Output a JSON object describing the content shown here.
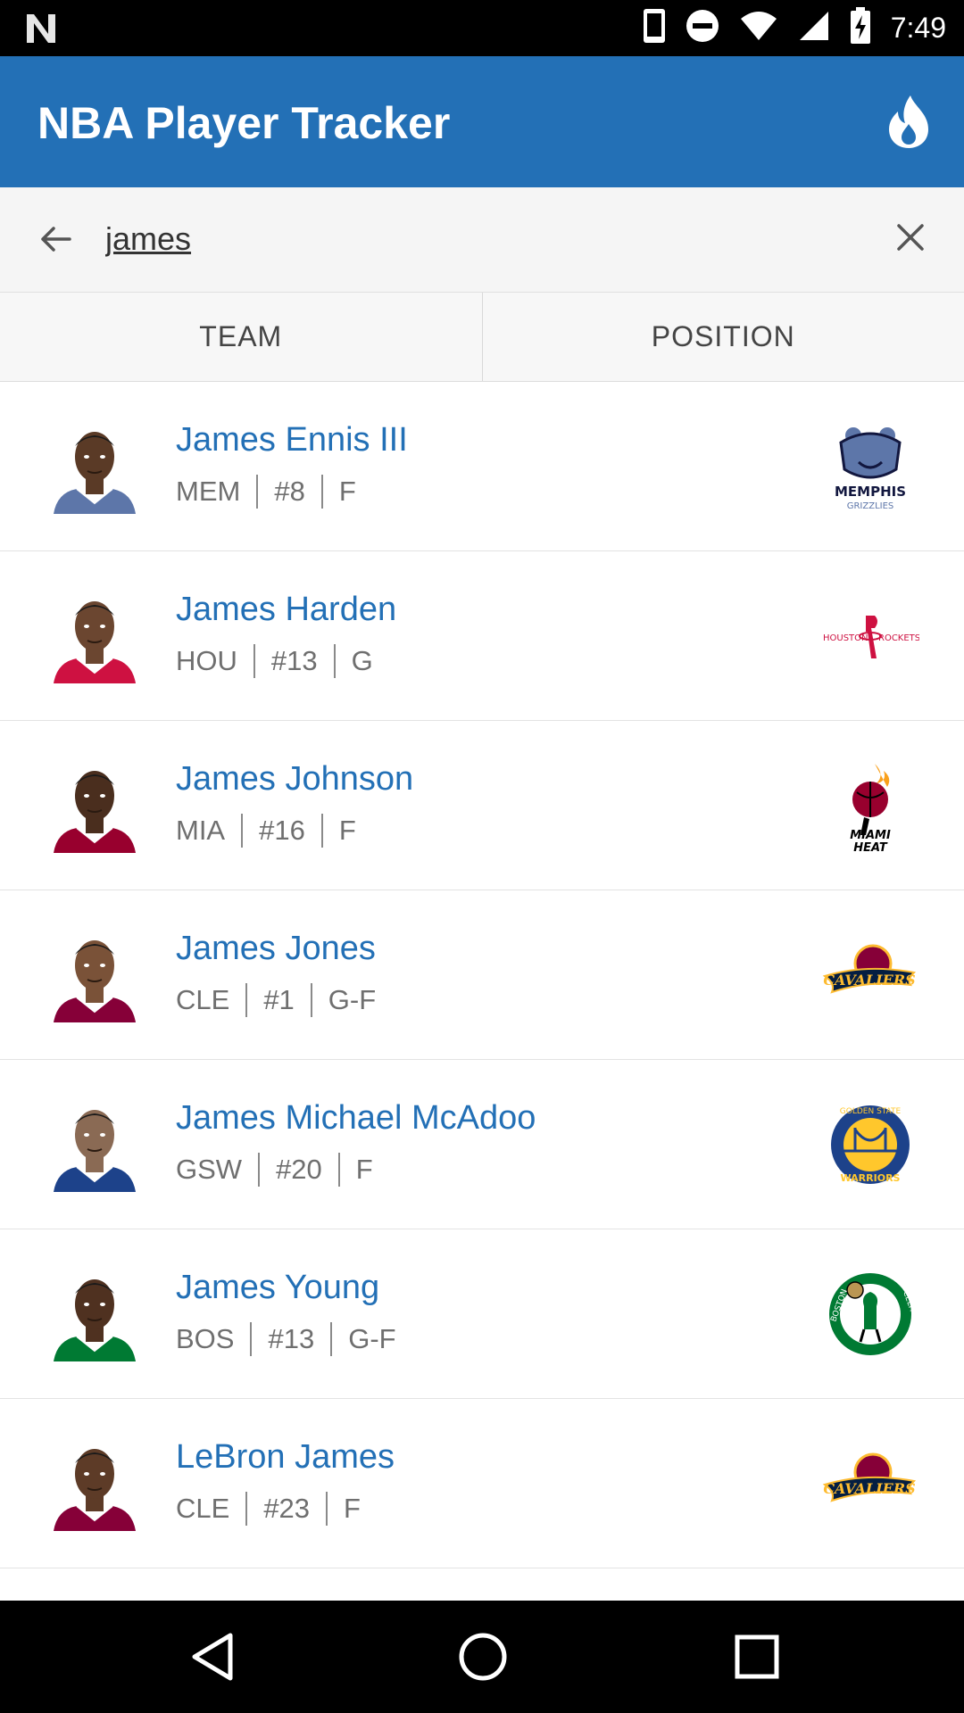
{
  "status_bar": {
    "time": "7:49",
    "icons": [
      "notification-n-icon",
      "phone-icon",
      "do-not-disturb-icon",
      "wifi-icon",
      "cell-signal-icon",
      "battery-charging-icon"
    ]
  },
  "app_bar": {
    "title": "NBA Player Tracker",
    "action_icon": "flame-icon"
  },
  "search": {
    "value": "james",
    "back_icon": "arrow-back-icon",
    "clear_icon": "close-icon"
  },
  "filters": {
    "team_label": "TEAM",
    "position_label": "POSITION"
  },
  "players": [
    {
      "name": "James Ennis III",
      "team": "MEM",
      "number": "#8",
      "position": "F",
      "logo": "memphis-grizzlies-logo",
      "jersey": "#5d76a9"
    },
    {
      "name": "James Harden",
      "team": "HOU",
      "number": "#13",
      "position": "G",
      "logo": "houston-rockets-logo",
      "jersey": "#ce1141"
    },
    {
      "name": "James Johnson",
      "team": "MIA",
      "number": "#16",
      "position": "F",
      "logo": "miami-heat-logo",
      "jersey": "#98002e"
    },
    {
      "name": "James Jones",
      "team": "CLE",
      "number": "#1",
      "position": "G-F",
      "logo": "cleveland-cavaliers-logo",
      "jersey": "#860038"
    },
    {
      "name": "James Michael McAdoo",
      "team": "GSW",
      "number": "#20",
      "position": "F",
      "logo": "golden-state-warriors-logo",
      "jersey": "#1d428a"
    },
    {
      "name": "James Young",
      "team": "BOS",
      "number": "#13",
      "position": "G-F",
      "logo": "boston-celtics-logo",
      "jersey": "#007a33"
    },
    {
      "name": "LeBron James",
      "team": "CLE",
      "number": "#23",
      "position": "F",
      "logo": "cleveland-cavaliers-logo",
      "jersey": "#860038"
    }
  ],
  "colors": {
    "primary": "#2370b6",
    "name_text": "#2370b6",
    "meta_text": "#6f6f6f"
  },
  "nav_bar": {
    "icons": [
      "nav-back-icon",
      "nav-home-icon",
      "nav-recents-icon"
    ]
  }
}
